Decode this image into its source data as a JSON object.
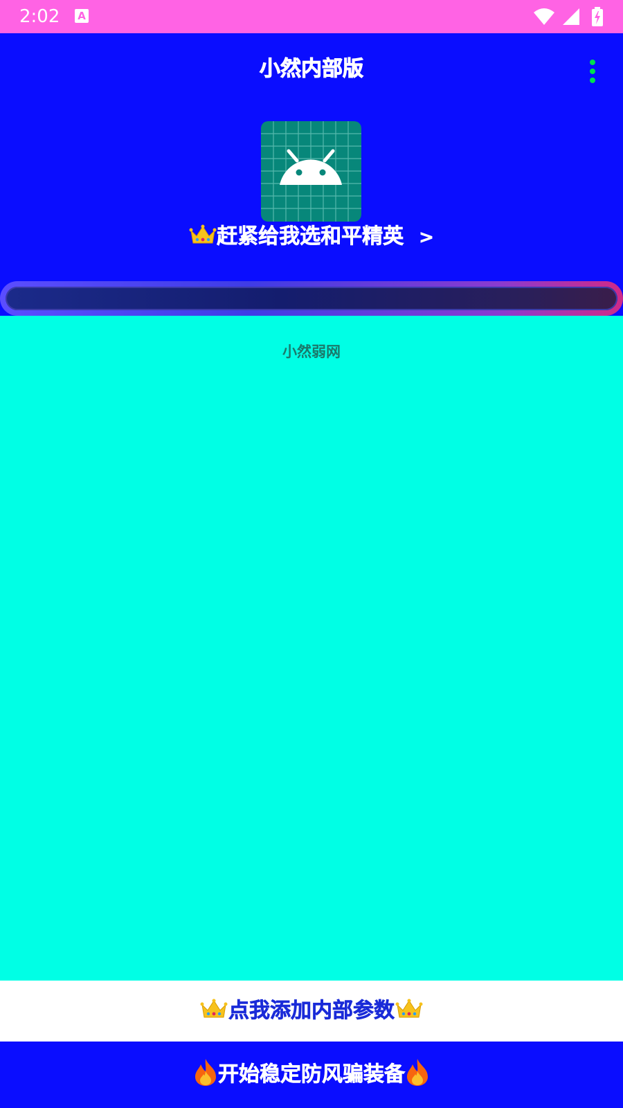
{
  "status_bar": {
    "time": "2:02",
    "notification_icon": "a-icon",
    "icons": [
      "wifi-icon",
      "signal-icon",
      "battery-charging-icon"
    ],
    "background": "#ff63e4"
  },
  "header": {
    "title": "小然内部版",
    "menu_icon": "more-vert-icon",
    "menu_icon_color": "#00e050",
    "background": "#0a0dff",
    "logo_icon": "android-icon",
    "promo_text": "赶紧给我选和平精英",
    "promo_chevron": ">",
    "promo_icon": "crown-icon"
  },
  "progress": {
    "value": 0
  },
  "content": {
    "label": "小然弱网",
    "background": "#00ffe5"
  },
  "buttons": {
    "add_params": "点我添加内部参数",
    "start": "开始稳定防风骗装备",
    "add_params_icon": "crown-icon",
    "start_icon": "flame-icon"
  }
}
